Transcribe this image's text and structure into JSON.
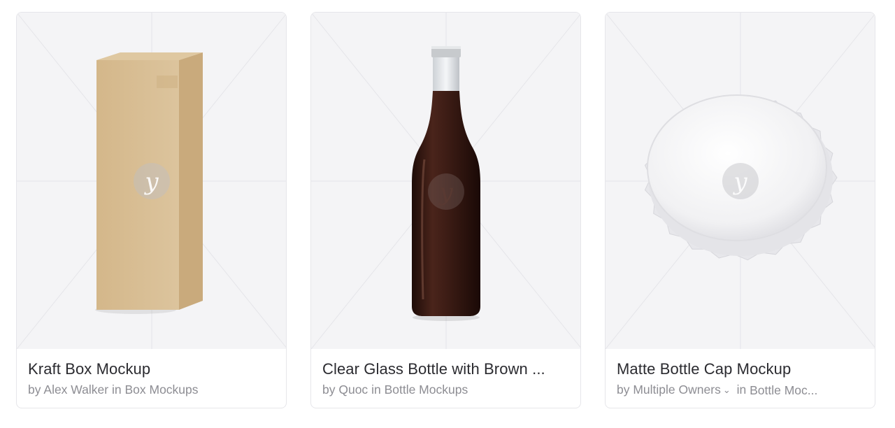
{
  "cards": [
    {
      "title": "Kraft Box Mockup",
      "by": "by",
      "author": "Alex Walker",
      "in": "in",
      "category": "Box Mockups",
      "watermark_icon": "yellow-images-logo-icon"
    },
    {
      "title": "Clear Glass Bottle with Brown ...",
      "by": "by",
      "author": "Quoc",
      "in": "in",
      "category": "Bottle Mockups",
      "watermark_icon": "yellow-images-logo-icon"
    },
    {
      "title": "Matte Bottle Cap Mockup",
      "by": "by",
      "author": "Multiple Owners",
      "in": "in",
      "category": "Bottle Moc...",
      "owners_dropdown_icon": "chevron-down-icon",
      "watermark_icon": "yellow-images-logo-icon"
    }
  ],
  "colors": {
    "preview_bg": "#f4f4f6",
    "title": "#2b2b30",
    "meta": "#8d8d93",
    "kraft": "#d8bf95",
    "liquid": "#3b1d17"
  }
}
